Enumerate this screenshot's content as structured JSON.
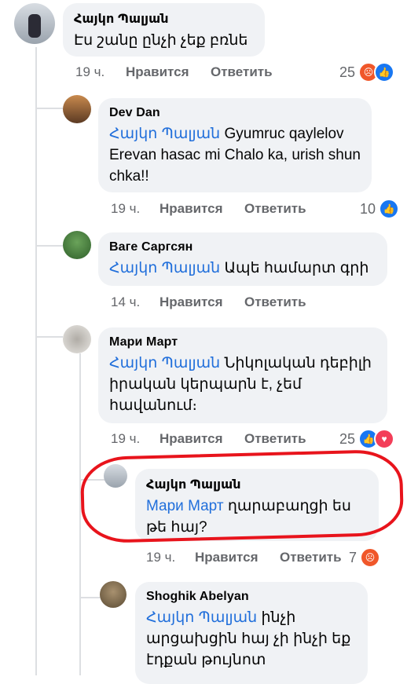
{
  "comments": [
    {
      "author": "Հայկո Պալյան",
      "mention": "",
      "text": "Էս շանը ընչի չեք բռնե",
      "time": "19 ч.",
      "like_label": "Нравится",
      "reply_label": "Ответить",
      "reaction_count": "25",
      "reactions": [
        "angry-react-icon",
        "like-react-icon"
      ]
    },
    {
      "author": "Dev Dan",
      "mention": "Հայկո Պալյան",
      "text": "Gyumruc qaylelov Erevan hasac mi Chalo ka, urish shun chka!!",
      "time": "19 ч.",
      "like_label": "Нравится",
      "reply_label": "Ответить",
      "reaction_count": "10",
      "reactions": [
        "like-react-icon"
      ]
    },
    {
      "author": "Ваге Саргсян",
      "mention": "Հայկո Պալյան",
      "text": "Ապե համարտ գրի",
      "time": "14 ч.",
      "like_label": "Нравится",
      "reply_label": "Ответить",
      "reaction_count": "",
      "reactions": []
    },
    {
      "author": "Мари Март",
      "mention": "Հայկո Պալյան",
      "text": " Նիկոլական դեբիլի  իրական կերպարն է, չեմ հավանում։",
      "time": "19 ч.",
      "like_label": "Нравится",
      "reply_label": "Ответить",
      "reaction_count": "25",
      "reactions": [
        "like-react-icon",
        "love-react-icon"
      ]
    },
    {
      "author": "Հայկո Պալյան",
      "mention": "Мари Март",
      "text": "ղարաբաղցի ես թե հայ?",
      "time": "19 ч.",
      "like_label": "Нравится",
      "reply_label": "Ответить",
      "reaction_count": "7",
      "reactions": [
        "angry-react-icon"
      ]
    },
    {
      "author": "Shoghik Abelyan",
      "mention": "Հայկո Պալյան",
      "text": "ինչի արցախցին հայ չի ինչի եք էդքան թույնոտ",
      "time": "",
      "like_label": "",
      "reply_label": "",
      "reaction_count": "",
      "reactions": []
    }
  ],
  "colors": {
    "mention": "#216fdb",
    "bubble": "#f0f2f5",
    "meta": "#65676b",
    "outline": "#e8141c"
  }
}
